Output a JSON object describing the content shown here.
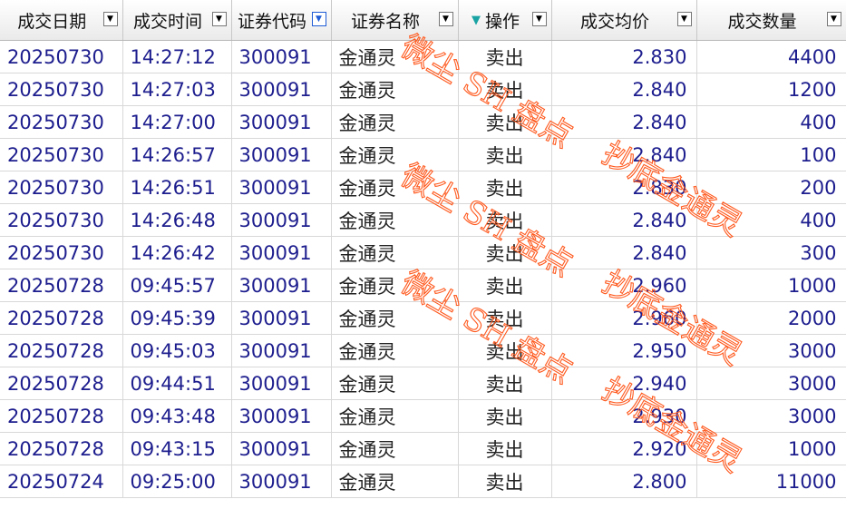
{
  "columns": [
    {
      "label": "成交日期"
    },
    {
      "label": "成交时间"
    },
    {
      "label": "证券代码"
    },
    {
      "label": "证券名称"
    },
    {
      "label": "操作",
      "filter": "▼"
    },
    {
      "label": "成交均价"
    },
    {
      "label": "成交数量"
    }
  ],
  "dropdown_glyph": "▼",
  "rows": [
    {
      "date": "20250730",
      "time": "14:27:12",
      "code": "300091",
      "name": "金通灵",
      "op": "卖出",
      "price": "2.830",
      "qty": "4400"
    },
    {
      "date": "20250730",
      "time": "14:27:03",
      "code": "300091",
      "name": "金通灵",
      "op": "卖出",
      "price": "2.840",
      "qty": "1200"
    },
    {
      "date": "20250730",
      "time": "14:27:00",
      "code": "300091",
      "name": "金通灵",
      "op": "卖出",
      "price": "2.840",
      "qty": "400"
    },
    {
      "date": "20250730",
      "time": "14:26:57",
      "code": "300091",
      "name": "金通灵",
      "op": "卖出",
      "price": "2.840",
      "qty": "100"
    },
    {
      "date": "20250730",
      "time": "14:26:51",
      "code": "300091",
      "name": "金通灵",
      "op": "卖出",
      "price": "2.830",
      "qty": "200"
    },
    {
      "date": "20250730",
      "time": "14:26:48",
      "code": "300091",
      "name": "金通灵",
      "op": "卖出",
      "price": "2.840",
      "qty": "400"
    },
    {
      "date": "20250730",
      "time": "14:26:42",
      "code": "300091",
      "name": "金通灵",
      "op": "卖出",
      "price": "2.840",
      "qty": "300"
    },
    {
      "date": "20250728",
      "time": "09:45:57",
      "code": "300091",
      "name": "金通灵",
      "op": "卖出",
      "price": "2.960",
      "qty": "1000"
    },
    {
      "date": "20250728",
      "time": "09:45:39",
      "code": "300091",
      "name": "金通灵",
      "op": "卖出",
      "price": "2.960",
      "qty": "2000"
    },
    {
      "date": "20250728",
      "time": "09:45:03",
      "code": "300091",
      "name": "金通灵",
      "op": "卖出",
      "price": "2.950",
      "qty": "3000"
    },
    {
      "date": "20250728",
      "time": "09:44:51",
      "code": "300091",
      "name": "金通灵",
      "op": "卖出",
      "price": "2.940",
      "qty": "3000"
    },
    {
      "date": "20250728",
      "time": "09:43:48",
      "code": "300091",
      "name": "金通灵",
      "op": "卖出",
      "price": "2.930",
      "qty": "3000"
    },
    {
      "date": "20250728",
      "time": "09:43:15",
      "code": "300091",
      "name": "金通灵",
      "op": "卖出",
      "price": "2.920",
      "qty": "1000"
    },
    {
      "date": "20250724",
      "time": "09:25:00",
      "code": "300091",
      "name": "金通灵",
      "op": "卖出",
      "price": "2.800",
      "qty": "11000"
    }
  ],
  "watermark": {
    "line1": "微尘 SH 盘点",
    "line2": "抄底金通灵",
    "color": "#ff5a1f"
  },
  "colors": {
    "cell_text": "#1d1d8e",
    "header_bg": "#eaeaea",
    "active_dropdown": "#1e5bd6",
    "filter_icon": "#1aa3a3"
  }
}
